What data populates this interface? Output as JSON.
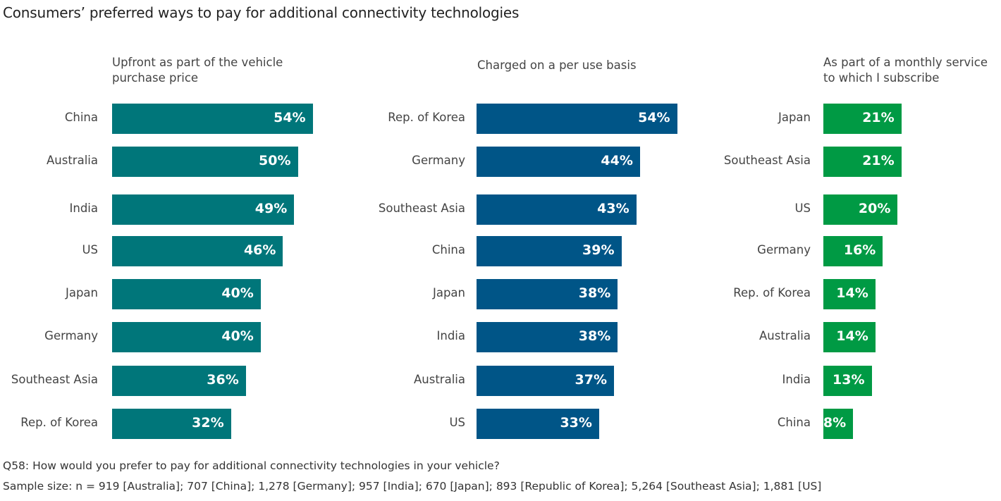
{
  "chart_data": [
    {
      "type": "bar",
      "orientation": "horizontal",
      "title": "Upfront as part of the vehicle purchase price",
      "categories": [
        "China",
        "Australia",
        "India",
        "US",
        "Japan",
        "Germany",
        "Southeast Asia",
        "Rep. of Korea"
      ],
      "values": [
        54,
        50,
        49,
        46,
        40,
        40,
        36,
        32
      ],
      "labels": [
        "54%",
        "50%",
        "49%",
        "46%",
        "40%",
        "40%",
        "36%",
        "32%"
      ],
      "unit": "%",
      "color": "#00767A",
      "xlim": [
        0,
        100
      ],
      "grid": false
    },
    {
      "type": "bar",
      "orientation": "horizontal",
      "title": "Charged on a per use basis",
      "categories": [
        "Rep. of Korea",
        "Germany",
        "Southeast Asia",
        "China",
        "Japan",
        "India",
        "Australia",
        "US"
      ],
      "values": [
        54,
        44,
        43,
        39,
        38,
        38,
        37,
        33
      ],
      "labels": [
        "54%",
        "44%",
        "43%",
        "39%",
        "38%",
        "38%",
        "37%",
        "33%"
      ],
      "unit": "%",
      "color": "#005587",
      "xlim": [
        0,
        100
      ],
      "grid": false
    },
    {
      "type": "bar",
      "orientation": "horizontal",
      "title": "As part of a monthly service to which I subscribe",
      "categories": [
        "Japan",
        "Southeast Asia",
        "US",
        "Germany",
        "Rep. of Korea",
        "Australia",
        "India",
        "China"
      ],
      "values": [
        21,
        21,
        20,
        16,
        14,
        14,
        13,
        8
      ],
      "labels": [
        "21%",
        "21%",
        "20%",
        "16%",
        "14%",
        "14%",
        "13%",
        "8%"
      ],
      "unit": "%",
      "color": "#009A44",
      "xlim": [
        0,
        100
      ],
      "grid": false
    }
  ],
  "header": {
    "title": "Consumers’ preferred ways to pay for additional connectivity technologies"
  },
  "panels": [
    {
      "title_line1": "Upfront as part of the vehicle",
      "title_line2": "purchase price"
    },
    {
      "title_line1": "Charged on a per use basis",
      "title_line2": ""
    },
    {
      "title_line1": "As part of a monthly service",
      "title_line2": "to which I subscribe"
    }
  ],
  "footer": {
    "question": "Q58: How would you prefer to pay for additional connectivity technologies in your vehicle?",
    "sample": "Sample size: n = 919 [Australia]; 707 [China]; 1,278 [Germany]; 957 [India];  670 [Japan]; 893 [Republic of Korea]; 5,264 [Southeast Asia]; 1,881 [US]"
  }
}
